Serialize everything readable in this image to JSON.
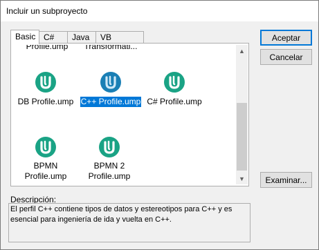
{
  "window": {
    "title": "Incluir un subproyecto"
  },
  "tabs": [
    {
      "label": "Basic",
      "active": true
    },
    {
      "label": "C#",
      "active": false
    },
    {
      "label": "Java",
      "active": false
    },
    {
      "label": "VB",
      "active": false
    }
  ],
  "items": [
    {
      "label": "Profile.ump",
      "icon": "umodel-icon",
      "partially_visible": true
    },
    {
      "label": "Transformati...",
      "icon": "umodel-icon",
      "partially_visible": true
    },
    {
      "label": "DB Profile.ump",
      "icon": "umodel-icon"
    },
    {
      "label": "C++ Profile.ump",
      "icon": "umodel-icon",
      "selected": true
    },
    {
      "label": "C# Profile.ump",
      "icon": "umodel-icon"
    },
    {
      "label": "BPMN Profile.ump",
      "line1": "BPMN",
      "line2": "Profile.ump",
      "icon": "umodel-icon"
    },
    {
      "label": "BPMN 2 Profile.ump",
      "line1": "BPMN 2",
      "line2": "Profile.ump",
      "icon": "umodel-icon"
    }
  ],
  "buttons": {
    "accept": "Aceptar",
    "cancel": "Cancelar",
    "browse": "Examinar..."
  },
  "description": {
    "label": "Descripción:",
    "text": "El perfil C++ contiene tipos de datos y estereotipos para C++ y es esencial para ingeniería de ida y vuelta en C++."
  },
  "colors": {
    "icon_teal": "#1aa385",
    "icon_selected": "#1a7fb5",
    "selection": "#0078d7"
  }
}
